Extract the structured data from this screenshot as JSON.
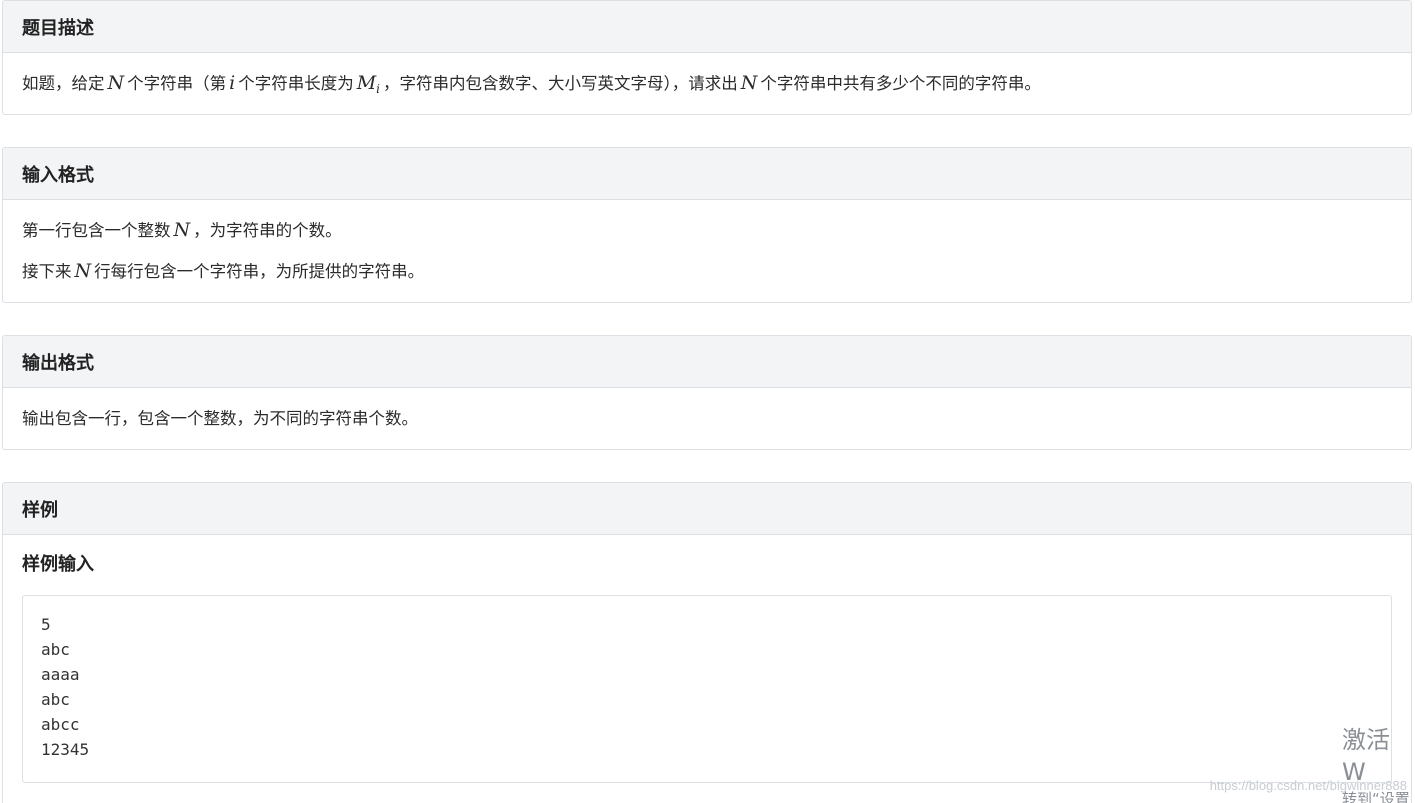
{
  "description": {
    "title": "题目描述",
    "text_1": "如题，给定",
    "var_n": "N",
    "text_2": "个字符串（第",
    "var_i": "i",
    "text_3": "个字符串长度为",
    "var_m": "M",
    "var_m_sub": "i",
    "text_4": "，字符串内包含数字、大小写英文字母），请求出",
    "var_n2": "N",
    "text_5": "个字符串中共有多少个不同的字符串。"
  },
  "input_format": {
    "title": "输入格式",
    "line1_a": "第一行包含一个整数",
    "line1_var": "N",
    "line1_b": "，为字符串的个数。",
    "line2_a": "接下来",
    "line2_var": "N",
    "line2_b": "行每行包含一个字符串，为所提供的字符串。"
  },
  "output_format": {
    "title": "输出格式",
    "line1": "输出包含一行，包含一个整数，为不同的字符串个数。"
  },
  "sample": {
    "title": "样例",
    "input_title": "样例输入",
    "input_lines": [
      "5",
      "abc",
      "aaaa",
      "abc",
      "abcc",
      "12345"
    ]
  },
  "overlay": {
    "activate_big": "激活 W",
    "activate_small": "转到“设置",
    "watermark": "https://blog.csdn.net/bigwinner888"
  }
}
